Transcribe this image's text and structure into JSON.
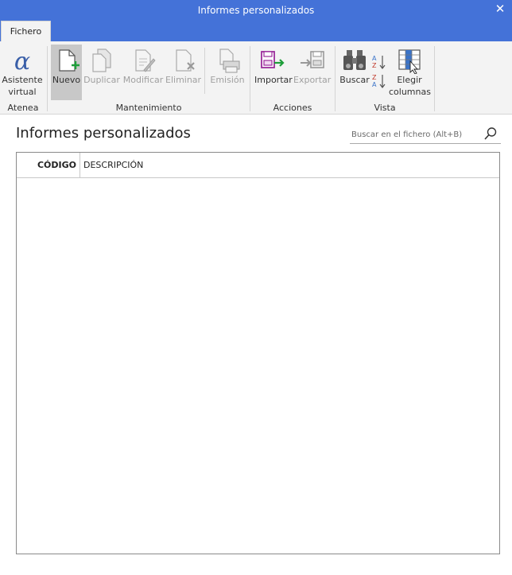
{
  "window": {
    "title": "Informes personalizados"
  },
  "tabs": [
    {
      "label": "Fichero"
    }
  ],
  "ribbon": {
    "buttons": {
      "asistente": {
        "label": "Asistente\nvirtual"
      },
      "nuevo": {
        "label": "Nuevo"
      },
      "duplicar": {
        "label": "Duplicar"
      },
      "modificar": {
        "label": "Modificar"
      },
      "eliminar": {
        "label": "Eliminar"
      },
      "emision": {
        "label": "Emisión"
      },
      "importar": {
        "label": "Importar"
      },
      "exportar": {
        "label": "Exportar"
      },
      "buscar": {
        "label": "Buscar"
      },
      "elegir": {
        "label": "Elegir\ncolumnas"
      }
    },
    "groups": {
      "atenea": "Atenea",
      "mantenimiento": "Mantenimiento",
      "acciones": "Acciones",
      "vista": "Vista"
    }
  },
  "main": {
    "title": "Informes personalizados",
    "search": {
      "placeholder": "Buscar en el fichero (Alt+B)"
    },
    "table": {
      "columns": [
        "CÓDIGO",
        "DESCRIPCIÓN"
      ],
      "rows": []
    }
  },
  "colors": {
    "accent": "#4472d8",
    "ribbon_bg": "#f3f3f3",
    "new_plus": "#1e9e3a",
    "import_purple": "#9b2d9b"
  }
}
